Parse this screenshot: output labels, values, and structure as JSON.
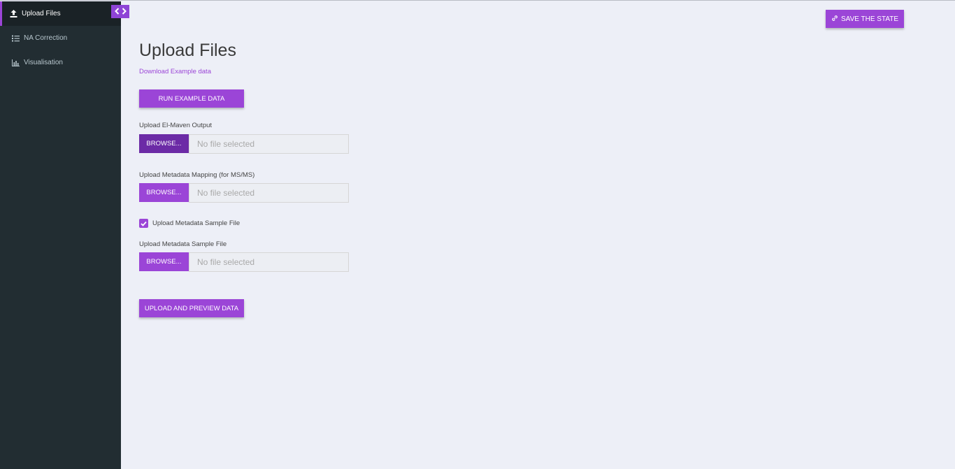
{
  "sidebar": {
    "toggle_icons": [
      "chevron-left-icon",
      "chevron-right-icon"
    ],
    "items": [
      {
        "label": "Upload Files",
        "icon": "upload-icon",
        "active": true
      },
      {
        "label": "NA Correction",
        "icon": "list-check-icon",
        "active": false
      },
      {
        "label": "Visualisation",
        "icon": "bar-chart-icon",
        "active": false
      }
    ]
  },
  "header": {
    "save_label": "SAVE THE STATE",
    "save_icon": "link-icon"
  },
  "main": {
    "title": "Upload Files",
    "download_link": "Download Example data",
    "run_example_label": "RUN EXAMPLE DATA",
    "uploads": [
      {
        "label": "Upload El-Maven Output",
        "browse_label": "BROWSE...",
        "file_placeholder": "No file selected"
      },
      {
        "label": "Upload Metadata Mapping (for MS/MS)",
        "browse_label": "BROWSE...",
        "file_placeholder": "No file selected"
      },
      {
        "label": "Upload Metadata Sample File",
        "browse_label": "BROWSE...",
        "file_placeholder": "No file selected"
      }
    ],
    "checkbox": {
      "label": "Upload Metadata Sample File",
      "checked": true
    },
    "upload_preview_label": "UPLOAD AND PREVIEW DATA"
  },
  "colors": {
    "accent": "#9b45d7",
    "accent_dark": "#6c2ba6",
    "sidebar_bg": "#222d32",
    "page_bg": "#edeff7"
  }
}
